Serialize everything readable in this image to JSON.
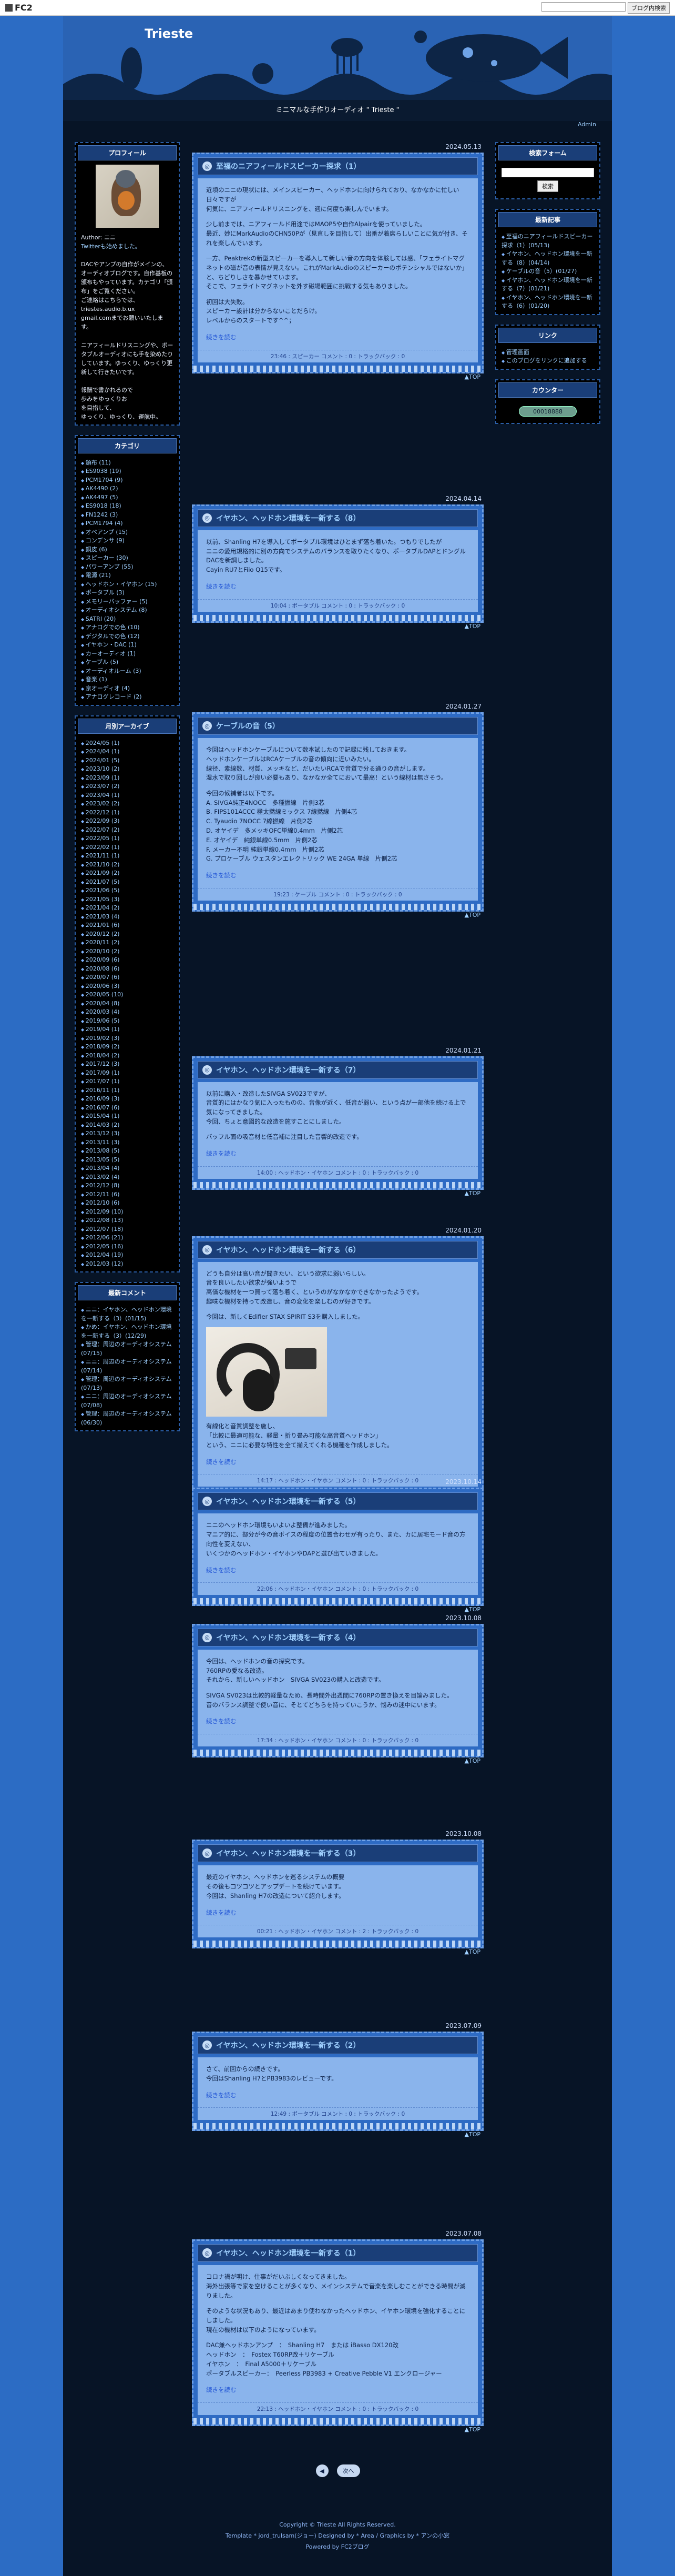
{
  "fc2": {
    "logo": "FC2",
    "search_placeholder": "",
    "button": "ブログ内検索"
  },
  "header": {
    "title": "Trieste",
    "tagline": "ミニマルな手作りオーディオ \" Trieste \"",
    "admin": "Admin"
  },
  "profile": {
    "title": "プロフィール",
    "author": "Author: ニニ",
    "twitter": "Twitterも始めました。",
    "bio": "DACやアンプの自作がメインの、オーディオブログです。自作基板の頒布もやっています。カテゴリ「頒布」をご覧ください。",
    "contact_lead": "ご連絡はこちらでは、",
    "email": "triestes.audio.b.ux",
    "email2": "gmail.comまでお願いいたします。",
    "policy": "ニアフィールドリスニングや、ポータブルオーディオにも手を染めたりしています。ゆっくり、ゆっくり更新して行きたいです。",
    "closing1": "報酬で書かれるので",
    "closing2": "歩みをゆっくりお",
    "closing3": "を目指して、",
    "closing4": "ゆっくり、ゆっくり、運航中。"
  },
  "categories": {
    "title": "カテゴリ",
    "items": [
      "頒布 (11)",
      "ES9038 (19)",
      "PCM1704 (9)",
      "AK4490 (2)",
      "AK4497 (5)",
      "ES9018 (18)",
      "FN1242 (3)",
      "PCM1794 (4)",
      "オペアンプ (15)",
      "コンデンサ (9)",
      "銅皮 (6)",
      "スピーカー (30)",
      "パワーアンプ (55)",
      "電源 (21)",
      "ヘッドホン・イヤホン (15)",
      "ポータブル (3)",
      "メモリーバッファー (5)",
      "オーディオシステム (8)",
      "SATRI (20)",
      "アナログでの色 (10)",
      "デジタルでの色 (12)",
      "イヤホン・DAC (1)",
      "カーオーディオ (1)",
      "ケーブル (5)",
      "オーディオルーム (3)",
      "音楽 (1)",
      "京オーディオ (4)",
      "アナログレコード (2)"
    ]
  },
  "archives": {
    "title": "月別アーカイブ",
    "items": [
      "2024/05 (1)",
      "2024/04 (1)",
      "2024/01 (5)",
      "2023/10 (2)",
      "2023/09 (1)",
      "2023/07 (2)",
      "2023/04 (1)",
      "2023/02 (2)",
      "2022/12 (1)",
      "2022/09 (3)",
      "2022/07 (2)",
      "2022/05 (1)",
      "2022/02 (1)",
      "2021/11 (1)",
      "2021/10 (2)",
      "2021/09 (2)",
      "2021/07 (5)",
      "2021/06 (5)",
      "2021/05 (3)",
      "2021/04 (2)",
      "2021/03 (4)",
      "2021/01 (6)",
      "2020/12 (2)",
      "2020/11 (2)",
      "2020/10 (2)",
      "2020/09 (6)",
      "2020/08 (6)",
      "2020/07 (6)",
      "2020/06 (3)",
      "2020/05 (10)",
      "2020/04 (8)",
      "2020/03 (4)",
      "2019/06 (5)",
      "2019/04 (1)",
      "2019/02 (3)",
      "2018/09 (2)",
      "2018/04 (2)",
      "2017/12 (3)",
      "2017/09 (1)",
      "2017/07 (1)",
      "2016/11 (1)",
      "2016/09 (3)",
      "2016/07 (6)",
      "2015/04 (1)",
      "2014/03 (2)",
      "2013/12 (3)",
      "2013/11 (3)",
      "2013/08 (5)",
      "2013/05 (5)",
      "2013/04 (4)",
      "2013/02 (4)",
      "2012/12 (8)",
      "2012/11 (6)",
      "2012/10 (6)",
      "2012/09 (10)",
      "2012/08 (13)",
      "2012/07 (18)",
      "2012/06 (21)",
      "2012/05 (16)",
      "2012/04 (19)",
      "2012/03 (12)"
    ]
  },
  "comments": {
    "title": "最新コメント",
    "items": [
      "ニニ：イヤホン、ヘッドホン環境を一新する（3）(01/15)",
      "かめ：イヤホン、ヘッドホン環境を一新する（3）(12/29)",
      "管理：周辺のオーディオシステム (07/15)",
      "ニニ：周辺のオーディオシステム (07/14)",
      "管理：周辺のオーディオシステム (07/13)",
      "ニニ：周辺のオーディオシステム (07/08)",
      "管理：周辺のオーディオシステム (06/30)"
    ]
  },
  "right": {
    "search_title": "検索フォーム",
    "search_button": "検索",
    "recent_title": "最新記事",
    "recent": [
      "至福のニアフィールドスピーカー探求（1）(05/13)",
      "イヤホン、ヘッドホン環境を一新する（8）(04/14)",
      "ケーブルの音（5）(01/27)",
      "イヤホン、ヘッドホン環境を一新する（7）(01/21)",
      "イヤホン、ヘッドホン環境を一新する（6）(01/20)"
    ],
    "link_title": "リンク",
    "links": [
      "管理画面",
      "このブログをリンクに追加する"
    ],
    "counter_title": "カウンター",
    "counter_value": "00018888"
  },
  "entries": [
    {
      "date": "2024.05.13",
      "title": "至福のニアフィールドスピーカー探求（1）",
      "body": [
        "近頃のニニの現状には、メインスピーカー、ヘッドホンに向けられており、なかなかに忙しい日々ですが",
        "何気に、ニアフィールドリスニングを、週に何度も楽しんでいます。",
        "",
        "少し前までは、ニアフィールド用途ではMAOP5や自作Alpairを使っていました。",
        "最近、妙にMarkAudioのCHN50Pが（見直しを目指して）出番が着席らしいことに気が付き、それを楽しんでいます。",
        "",
        "一方、Peaktrekの新型スピーカーを導入して新しい音の方向を体験しては感、「フェライトマグネットの磁が音の表情が見えない。これがMarkAudioのスピーカーのポテンシャルではないか」と、ちどりしさを暴かせています。",
        "そこで、フェライトマグネットを外す磁場範囲に挑戦する気もありました。",
        "",
        "初回は大失敗。",
        "スピーカー設計は分からないことだらけ。",
        "レベルからのスタートです^^；"
      ],
      "more": "続きを読む",
      "foot": "23:46 : スピーカー  コメント : 0 : トラックバック : 0"
    },
    {
      "date": "2024.04.14",
      "title": "イヤホン、ヘッドホン環境を一新する（8）",
      "body": [
        "以前、Shanling H7を導入してポータブル環境はひとまず落ち着いた。つもりでしたが",
        "ニニの愛用規格的に別の方向でシステムのバランスを取りたくなり、ポータブルDAPとドングルDACを新調しました。",
        "Cayin RU7とFiio Q15です。"
      ],
      "more": "続きを読む",
      "foot": "10:04 : ポータブル  コメント : 0 : トラックバック : 0"
    },
    {
      "date": "2024.01.27",
      "title": "ケーブルの音（5）",
      "body": [
        "今回はヘッドホンケーブルについて数本試したので記録に残しておきます。",
        "ヘッドホンケーブルはRCAケーブルの音の傾向に近いみたい。",
        "線径、素線数、材質、メッキなど、だいたいRCAで音質で分る通りの音がします。",
        "湿水で取り回しが良い必要もあり、なかなか全てにおいて最高！という線材は無さそう。",
        "",
        "今回の候補者は以下です。",
        "A. SIVGA純正4NOCC　多種撚線　片側3芯",
        "B. FIPS101ACCC 極太撚線ミックス 7線撚線　片側4芯",
        "C. Tyaudio 7NOCC 7線撚線　片側2芯",
        "D. オヤイデ　多メッキOFC単線0.4mm　片側2芯",
        "E. オヤイデ　純銀単線0.5mm　片側2芯",
        "F. メーカー不明 純銀単線0.4mm　片側2芯",
        "G. プロケーブル ウェスタンエレクトリック WE 24GA 単線　片側2芯"
      ],
      "more": "続きを読む",
      "foot": "19:23 : ケーブル  コメント : 0 : トラックバック : 0"
    },
    {
      "date": "2024.01.21",
      "title": "イヤホン、ヘッドホン環境を一新する（7）",
      "body": [
        "以前に購入・改造したSIVGA SV023ですが、",
        "音質的にはかなり気に入ったものの、音像が近く、低音が弱い、という点が一部他を続ける上で気になってきました。",
        "今回、ちょと意図的な改造を施すことにしました。",
        "",
        "バッフル面の吸音材と低音補に注目した音響的改造です。"
      ],
      "more": "続きを読む",
      "foot": "14:00 : ヘッドホン・イヤホン  コメント : 0 : トラックバック : 0"
    },
    {
      "date": "2024.01.20",
      "title": "イヤホン、ヘッドホン環境を一新する（6）",
      "body": [
        "どうも自分は高い音が聞きたい、という欲求に弱いらしい。",
        "音を良いしたい欲求が強いようで",
        "高価な機材を一つ買って落ち着く、というのがなかなかできなかったようです。",
        "趣味な機材を持って改造し、音の変化を楽しむのが好きです。",
        "",
        "今回は、新しくEdifier STAX SPIRIT S3を購入しました。"
      ],
      "photo": true,
      "body2": [
        "有線化と音質調整を施し、",
        "「比較に最適可能な、軽量・折り畳み可能な高音質ヘッドホン」",
        "という、ニニに必要な特性を全て揃えてくれる機種を作成しました。"
      ],
      "more": "続きを読む",
      "foot": "14:17 : ヘッドホン・イヤホン  コメント : 0 : トラックバック : 0"
    },
    {
      "date": "2023.10.14",
      "title": "イヤホン、ヘッドホン環境を一新する（5）",
      "body": [
        "ニニのヘッドホン環境もいよいよ整備が進みました。",
        "マニア的に、部分が今の音ボイスの程度の位置合わせが有ったり、また、カに居宅モード音の方向性を変えない、",
        "いくつかのヘッドホン・イヤホンやDAPと選び出ていきました。"
      ],
      "more": "続きを読む",
      "foot": "22:06 : ヘッドホン・イヤホン  コメント : 0 : トラックバック : 0"
    },
    {
      "date": "2023.10.08",
      "title": "イヤホン、ヘッドホン環境を一新する（4）",
      "body": [
        "今回は、ヘッドホンの音の探究です。",
        "760RPの愛なる改造。",
        "それから、新しいヘッドホン　SIVGA SV023の購入と改造です。",
        "",
        "SIVGA SV023は比較的軽量なため、長時間外出週間に760RPの置き換えを目論みました。",
        "音のバランス調整で使い音に、そとてどちらを持っていこうか、悩みの迷中にいます。"
      ],
      "more": "続きを読む",
      "foot": "17:34 : ヘッドホン・イヤホン  コメント : 0 : トラックバック : 0"
    },
    {
      "date": "2023.10.08",
      "title": "イヤホン、ヘッドホン環境を一新する（3）",
      "body": [
        "最近のイヤホン、ヘッドホンを巡るシステムの概要",
        "その後もコツコツとアップデートを続けています。",
        "今回は、Shanling H7の改造について紹介します。"
      ],
      "more": "続きを読む",
      "foot": "00:21 : ヘッドホン・イヤホン  コメント : 2 : トラックバック : 0"
    },
    {
      "date": "2023.07.09",
      "title": "イヤホン、ヘッドホン環境を一新する（2）",
      "body": [
        "さて、前回からの続きです。",
        "今回はShanling H7とPB3983のレビューです。"
      ],
      "more": "続きを読む",
      "foot": "12:49 : ポータブル  コメント : 0 : トラックバック : 0"
    },
    {
      "date": "2023.07.08",
      "title": "イヤホン、ヘッドホン環境を一新する（1）",
      "body": [
        "コロナ禍が明け、仕事がだいぶしくなってきました。",
        "海外出張等で家を空けることが多くなり、メインシステムで音楽を楽しむことができる時間が減りました。",
        "",
        "そのような状況もあり、最近はあまり使わなかったヘッドホン、イヤホン環境を強化することにしました。",
        "現在の機材は以下のようになっています。",
        "",
        "DAC兼ヘッドホンアンプ　：　Shanling H7　または iBasso DX120改",
        "ヘッドホン　：　Fostex T60RP改＋リケーブル",
        "イヤホン　：　Final A5000＋リケーブル",
        "ポータブルスピーカー：　Peerless PB3983 + Creative Pebble V1 エンクロージャー"
      ],
      "more": "続きを読む",
      "foot": "22:13 : ヘッドホン・イヤホン  コメント : 0 : トラックバック : 0"
    }
  ],
  "top_label": "▲TOP",
  "pager": {
    "prev": "◀",
    "next": "次へ"
  },
  "footer": {
    "copyright": "Copyright © Trieste All Rights Reserved.",
    "credits": "Template * jord_trulsam(ジョー) Designed by * Area / Graphics by * アンの小窓",
    "powered": "Powered by FC2ブログ"
  }
}
